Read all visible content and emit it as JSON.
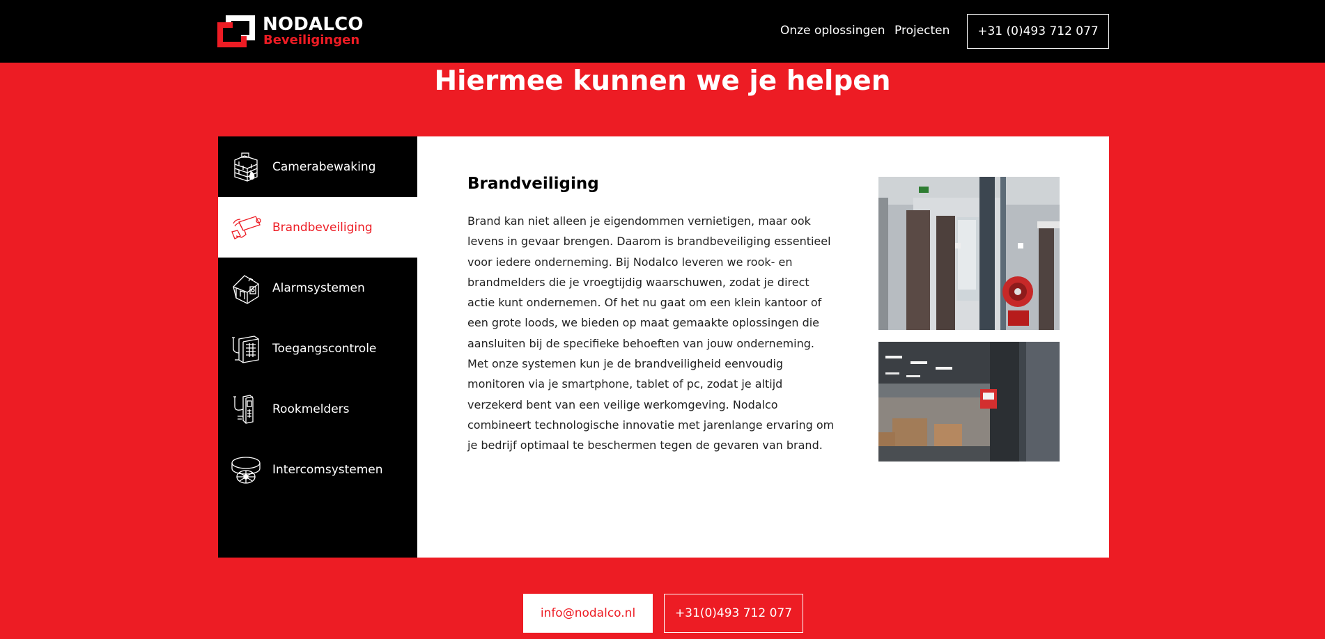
{
  "header": {
    "logo": {
      "name": "NODALCO",
      "sub": "Beveiligingen"
    },
    "nav": [
      {
        "label": "Onze oplossingen"
      },
      {
        "label": "Projecten"
      }
    ],
    "phone_button": "+31 (0)493 712 077"
  },
  "section": {
    "title": "Hiermee kunnen we je helpen"
  },
  "tabs": [
    {
      "label": "Camerabewaking",
      "icon": "brick-wall-fire-icon",
      "active": false
    },
    {
      "label": "Brandbeveiliging",
      "icon": "security-camera-icon",
      "active": true
    },
    {
      "label": "Alarmsystemen",
      "icon": "house-alarm-icon",
      "active": false
    },
    {
      "label": "Toegangscontrole",
      "icon": "keypad-panel-icon",
      "active": false
    },
    {
      "label": "Rookmelders",
      "icon": "door-lock-keypad-icon",
      "active": false
    },
    {
      "label": "Intercomsystemen",
      "icon": "smoke-detector-icon",
      "active": false
    }
  ],
  "active_content": {
    "title": "Brandveiliging",
    "paragraph_1": "Brand kan niet alleen je eigendommen vernietigen, maar ook levens in gevaar brengen. Daarom is brandbeveiliging essentieel voor iedere onderneming. Bij Nodalco leveren we rook- en brandmelders die je vroegtijdig waarschuwen, zodat je direct actie kunt ondernemen. Of het nu gaat om een klein kantoor of een grote loods, we bieden op maat gemaakte oplossingen die aansluiten bij de specifieke behoeften van jouw onderneming.",
    "paragraph_2": "Met onze systemen kun je de brandveiligheid eenvoudig monitoren via je smartphone, tablet of pc, zodat je altijd verzekerd bent van een veilige werkomgeving. Nodalco combineert technologische innovatie met jarenlange ervaring om je bedrijf optimaal te beschermen tegen de gevaren van brand."
  },
  "footer": {
    "email_button": "info@nodalco.nl",
    "phone_button": "+31(0)493 712 077"
  },
  "colors": {
    "brand_red": "#ed1c24",
    "black": "#000000",
    "white": "#ffffff"
  }
}
